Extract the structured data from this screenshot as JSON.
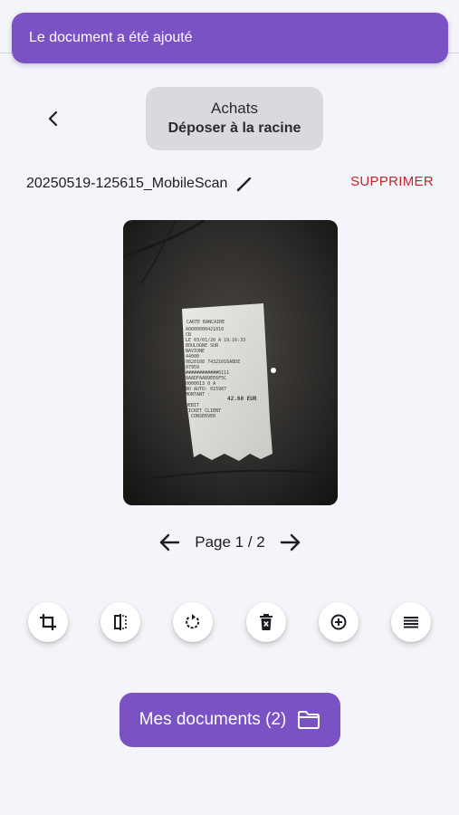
{
  "colors": {
    "accent": "#7b52c4",
    "danger": "#c4242b",
    "background": "#f4f5fa",
    "dest_button_bg": "#dadade"
  },
  "toast": {
    "message": "Le document a été ajouté"
  },
  "destination": {
    "folder": "Achats",
    "action": "Déposer à la racine"
  },
  "document": {
    "filename": "20250519-125615_MobileScan",
    "delete_label": "SUPPRIMER"
  },
  "pager": {
    "label": "Page 1 / 2"
  },
  "receipt": {
    "lines": [
      "CARTE BANCAIRE",
      "A0000000421010",
      "CB",
      "LE 03/01/20 A 19:16:33",
      "BOULOGNE SUR",
      "NAVIONE",
      "44000",
      "0820108 74321016ABDE",
      "07959",
      "############6111",
      "8A8DFAAB9EE6F5C",
      "0000013 0 A",
      "NO AUTO: 015967",
      "MONTANT :"
    ],
    "amount": "42.60 EUR",
    "footer": [
      "DEBIT",
      "TICKET CLIENT",
      "A CONSERVER"
    ]
  },
  "tools": [
    {
      "name": "crop-button",
      "icon": "crop-icon"
    },
    {
      "name": "compare-button",
      "icon": "split-view-icon"
    },
    {
      "name": "rotate-button",
      "icon": "rotate-icon"
    },
    {
      "name": "delete-page-button",
      "icon": "trash-icon"
    },
    {
      "name": "add-page-button",
      "icon": "add-circle-icon"
    },
    {
      "name": "reorder-button",
      "icon": "list-icon"
    }
  ],
  "footer": {
    "docs_label": "Mes documents (2)",
    "icon": "folder-icon"
  }
}
